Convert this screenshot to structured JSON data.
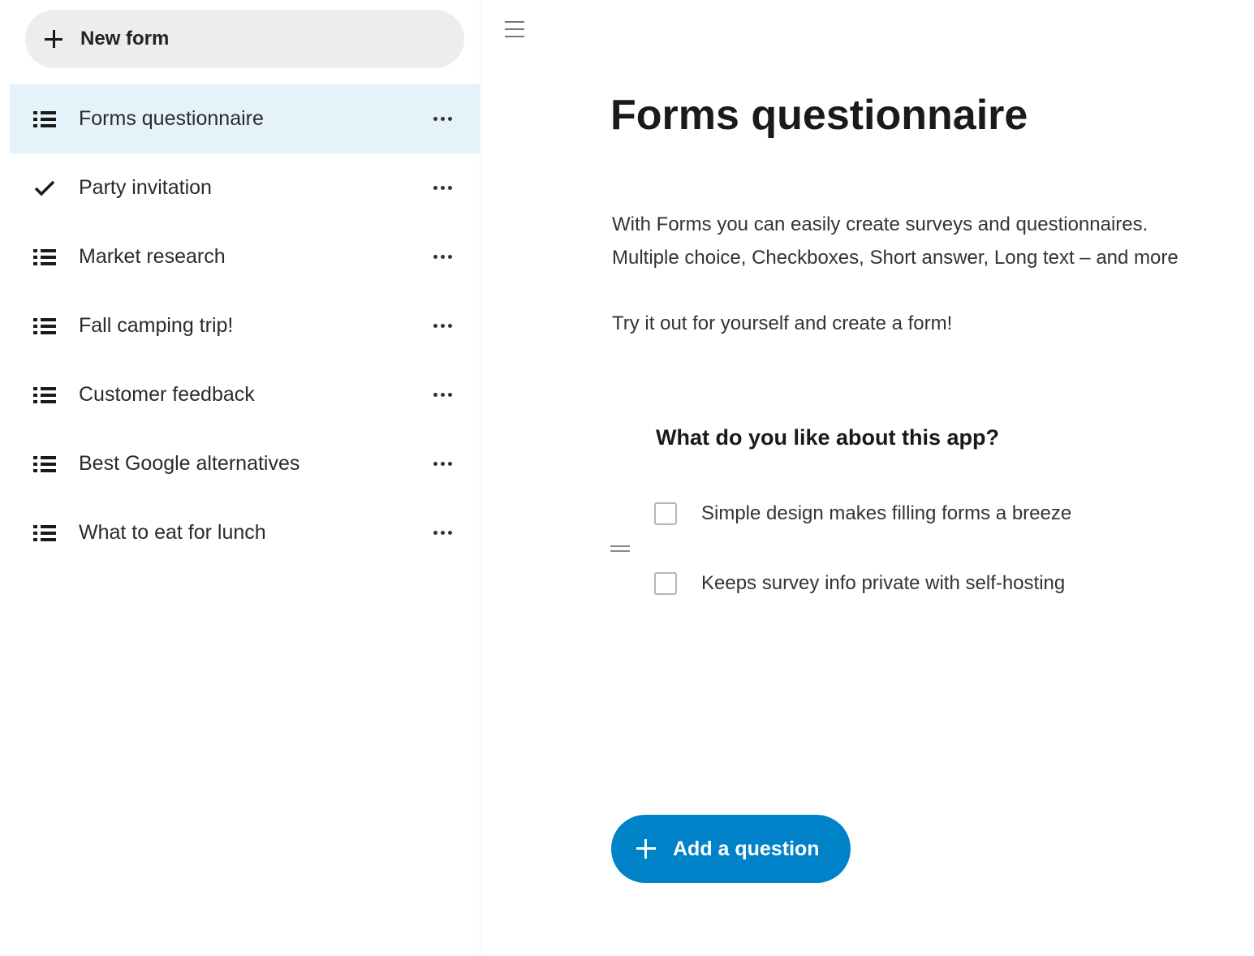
{
  "colors": {
    "accent": "#0082c9",
    "active_item_bg": "#e6f2fa",
    "new_form_bg": "#ededed"
  },
  "sidebar": {
    "new_form": {
      "icon": "plus-icon",
      "label": "New form"
    },
    "items": [
      {
        "icon": "list-icon",
        "label": "Forms questionnaire",
        "active": true
      },
      {
        "icon": "checkmark-icon",
        "label": "Party invitation",
        "active": false
      },
      {
        "icon": "list-icon",
        "label": "Market research",
        "active": false
      },
      {
        "icon": "list-icon",
        "label": "Fall camping trip!",
        "active": false
      },
      {
        "icon": "list-icon",
        "label": "Customer feedback",
        "active": false
      },
      {
        "icon": "list-icon",
        "label": "Best Google alternatives",
        "active": false
      },
      {
        "icon": "list-icon",
        "label": "What to eat for lunch",
        "active": false
      }
    ],
    "more_icon": "more-horizontal-icon"
  },
  "main": {
    "menu_icon": "hamburger-menu-icon",
    "title": "Forms questionnaire",
    "description": {
      "line1": "With Forms you can easily create surveys and questionnaires.",
      "line2": "Multiple choice, Checkboxes, Short answer, Long text – and more",
      "line3": "Try it out for yourself and create a form!"
    },
    "question": {
      "title": "What do you like about this app?",
      "drag_icon": "drag-handle-icon",
      "options": [
        {
          "label": "Simple design makes filling forms a breeze",
          "checked": false
        },
        {
          "label": "Keeps survey info private with self-hosting",
          "checked": false
        }
      ]
    },
    "add_question": {
      "icon": "plus-icon",
      "label": "Add a question"
    }
  }
}
